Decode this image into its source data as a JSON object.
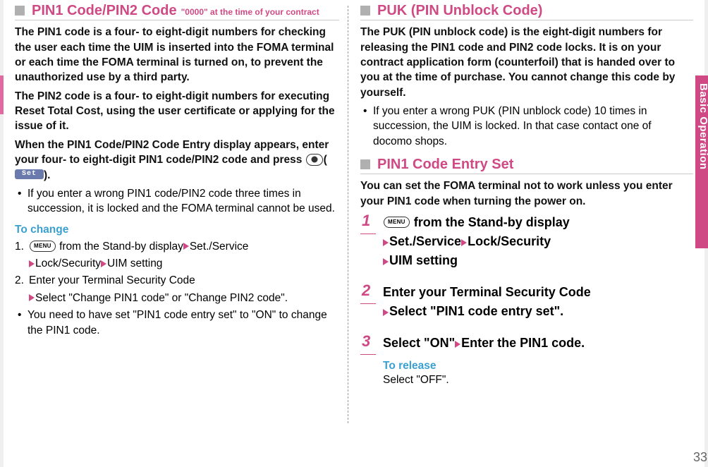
{
  "left": {
    "section_a": {
      "title": "PIN1 Code/PIN2 Code",
      "subtitle": "\"0000\" at the time of your contract",
      "para1": "The PIN1 code is a four- to eight-digit numbers for checking the user each time the UIM is inserted into the FOMA terminal or each time the FOMA terminal is turned on, to prevent the unauthorized use by a third party.",
      "para2": "The PIN2 code is a four- to eight-digit numbers for executing Reset Total Cost, using the user certificate or applying for the issue of it.",
      "para3_a": "When the PIN1 Code/PIN2 Code Entry display appears, enter your four- to eight-digit PIN1 code/PIN2 code and press ",
      "para3_b": "(",
      "set_lozenge": "Set",
      "para3_c": ").",
      "bullet1": "If you enter a wrong PIN1 code/PIN2 code three times in succession, it is locked and the FOMA terminal cannot be used."
    },
    "to_change": {
      "heading": "To change",
      "line1_a": "1.",
      "line1_b": " from the Stand-by display",
      "line1_c": "Set./Service",
      "line1_d": "Lock/Security",
      "line1_e": "UIM setting",
      "line2_a": "2.",
      "line2_b": "Enter your Terminal Security Code",
      "line2_c": "Select \"Change PIN1 code\" or \"Change PIN2 code\".",
      "bullet": "You need to have set \"PIN1 code entry set\" to \"ON\" to change the PIN1 code."
    }
  },
  "right": {
    "section_puk": {
      "title": "PUK (PIN Unblock Code)",
      "para": "The PUK (PIN unblock code) is the eight-digit numbers for releasing the PIN1 code and PIN2 code locks. It is on your contract application form (counterfoil) that is handed over to you at the time of purchase. You cannot change this code by yourself.",
      "bullet": "If you enter a wrong PUK (PIN unblock code) 10 times in succession, the UIM is locked. In that case contact one of docomo shops."
    },
    "section_entry": {
      "title": "PIN1 Code Entry Set",
      "para": "You can set the FOMA terminal not to work unless you enter your PIN1 code when turning the power on."
    },
    "steps": {
      "s1": {
        "num": "1",
        "a": " from the Stand-by display",
        "b": "Set./Service",
        "c": "Lock/Security",
        "d": "UIM setting"
      },
      "s2": {
        "num": "2",
        "a": "Enter your Terminal Security Code",
        "b": "Select \"PIN1 code entry set\"."
      },
      "s3": {
        "num": "3",
        "a": "Select \"ON\"",
        "b": "Enter the PIN1 code.",
        "note_blue": "To release",
        "note": "Select \"OFF\"."
      }
    }
  },
  "rail_label": "Basic Operation",
  "page_number": "33",
  "menu_label": "MENU"
}
